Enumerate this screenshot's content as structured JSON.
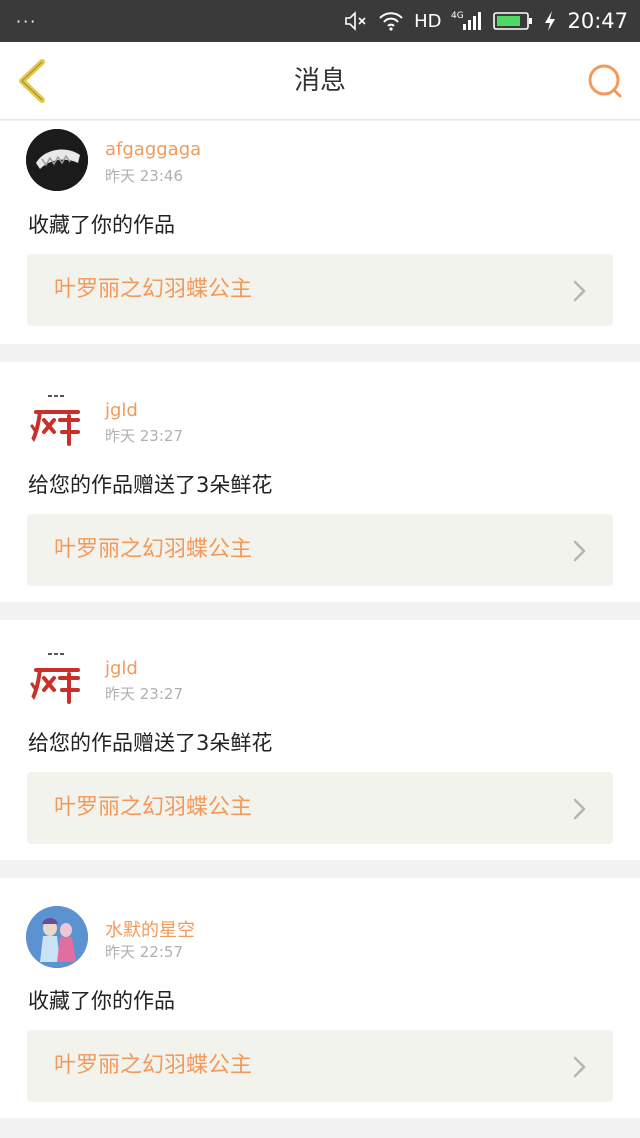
{
  "status_bar": {
    "notifications": "···",
    "network": "HD",
    "signal_type": "4G",
    "time": "20:47"
  },
  "nav": {
    "title": "消息",
    "back_icon": "chevron-left-icon",
    "search_icon": "search-icon"
  },
  "colors": {
    "accent": "#f39a5b",
    "back_icon": "#e3c94a"
  },
  "messages": [
    {
      "username": "afgaggaga",
      "time": "昨天 23:46",
      "action": "收藏了你的作品",
      "work_title": "叶罗丽之幻羽蝶公主",
      "avatar": "dark-avatar"
    },
    {
      "username": "jgld",
      "time": "昨天 23:27",
      "action": "给您的作品赠送了3朵鲜花",
      "work_title": "叶罗丽之幻羽蝶公主",
      "avatar": "calligraphy-avatar"
    },
    {
      "username": "jgld",
      "time": "昨天 23:27",
      "action": "给您的作品赠送了3朵鲜花",
      "work_title": "叶罗丽之幻羽蝶公主",
      "avatar": "calligraphy-avatar"
    },
    {
      "username": "水默的星空",
      "time": "昨天 22:57",
      "action": "收藏了你的作品",
      "work_title": "叶罗丽之幻羽蝶公主",
      "avatar": "anime-avatar"
    }
  ]
}
